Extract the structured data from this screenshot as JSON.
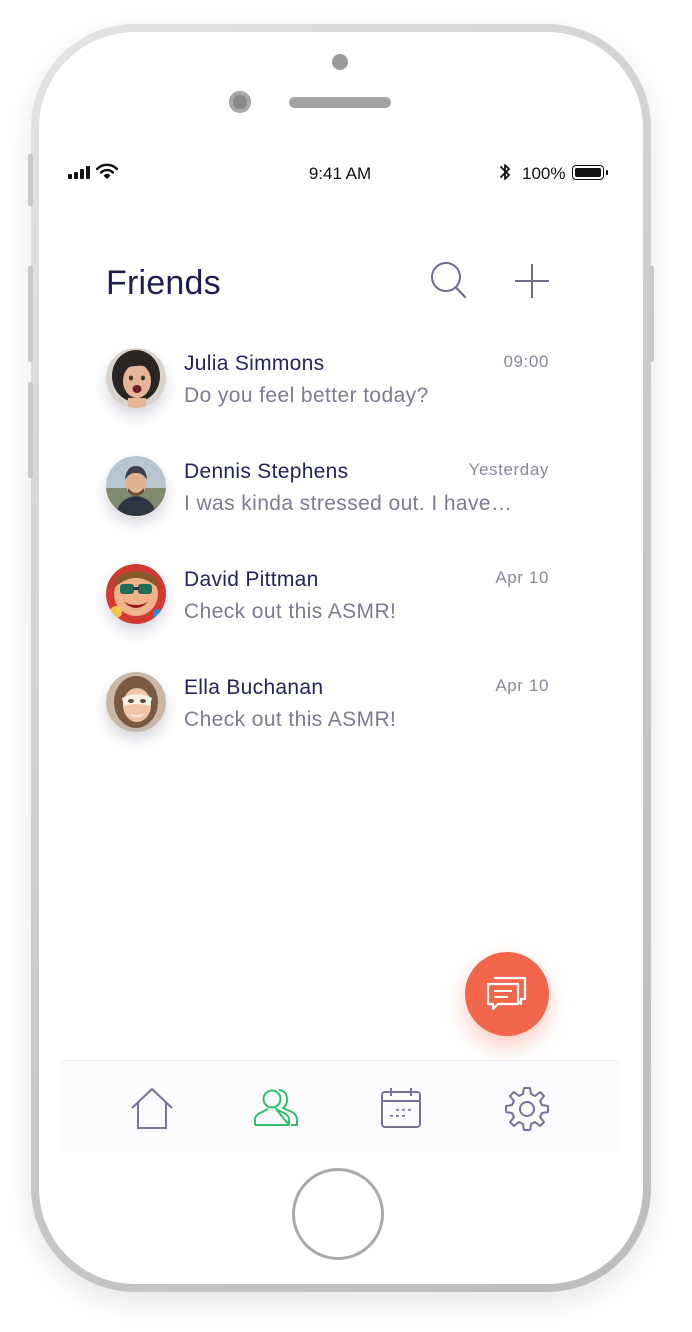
{
  "status_bar": {
    "time": "9:41 AM",
    "battery_percent": "100%",
    "icons": [
      "signal-icon",
      "wifi-icon",
      "bluetooth-icon",
      "battery-icon"
    ]
  },
  "header": {
    "title": "Friends",
    "search_icon": "search-icon",
    "add_icon": "plus-icon"
  },
  "friends": [
    {
      "name": "Julia Simmons",
      "message": "Do you feel better today?",
      "time": "09:00",
      "avatar_color": "#3c3a3a"
    },
    {
      "name": "Dennis Stephens",
      "message": "I was kinda stressed out. I have…",
      "time": "Yesterday",
      "avatar_color": "#5d6e7f"
    },
    {
      "name": "David Pittman",
      "message": "Check out this ASMR!",
      "time": "Apr 10",
      "avatar_color": "#c2352f"
    },
    {
      "name": "Ella Buchanan",
      "message": "Check out this ASMR!",
      "time": "Apr 10",
      "avatar_color": "#b59784"
    }
  ],
  "fab": {
    "icon": "chat-icon",
    "color": "#f2664b"
  },
  "tabbar": {
    "tabs": [
      {
        "icon": "home-icon",
        "active": false
      },
      {
        "icon": "friends-icon",
        "active": true
      },
      {
        "icon": "calendar-icon",
        "active": false
      },
      {
        "icon": "settings-icon",
        "active": false
      }
    ],
    "active_color": "#2dbf6b",
    "inactive_color": "#74739a"
  }
}
